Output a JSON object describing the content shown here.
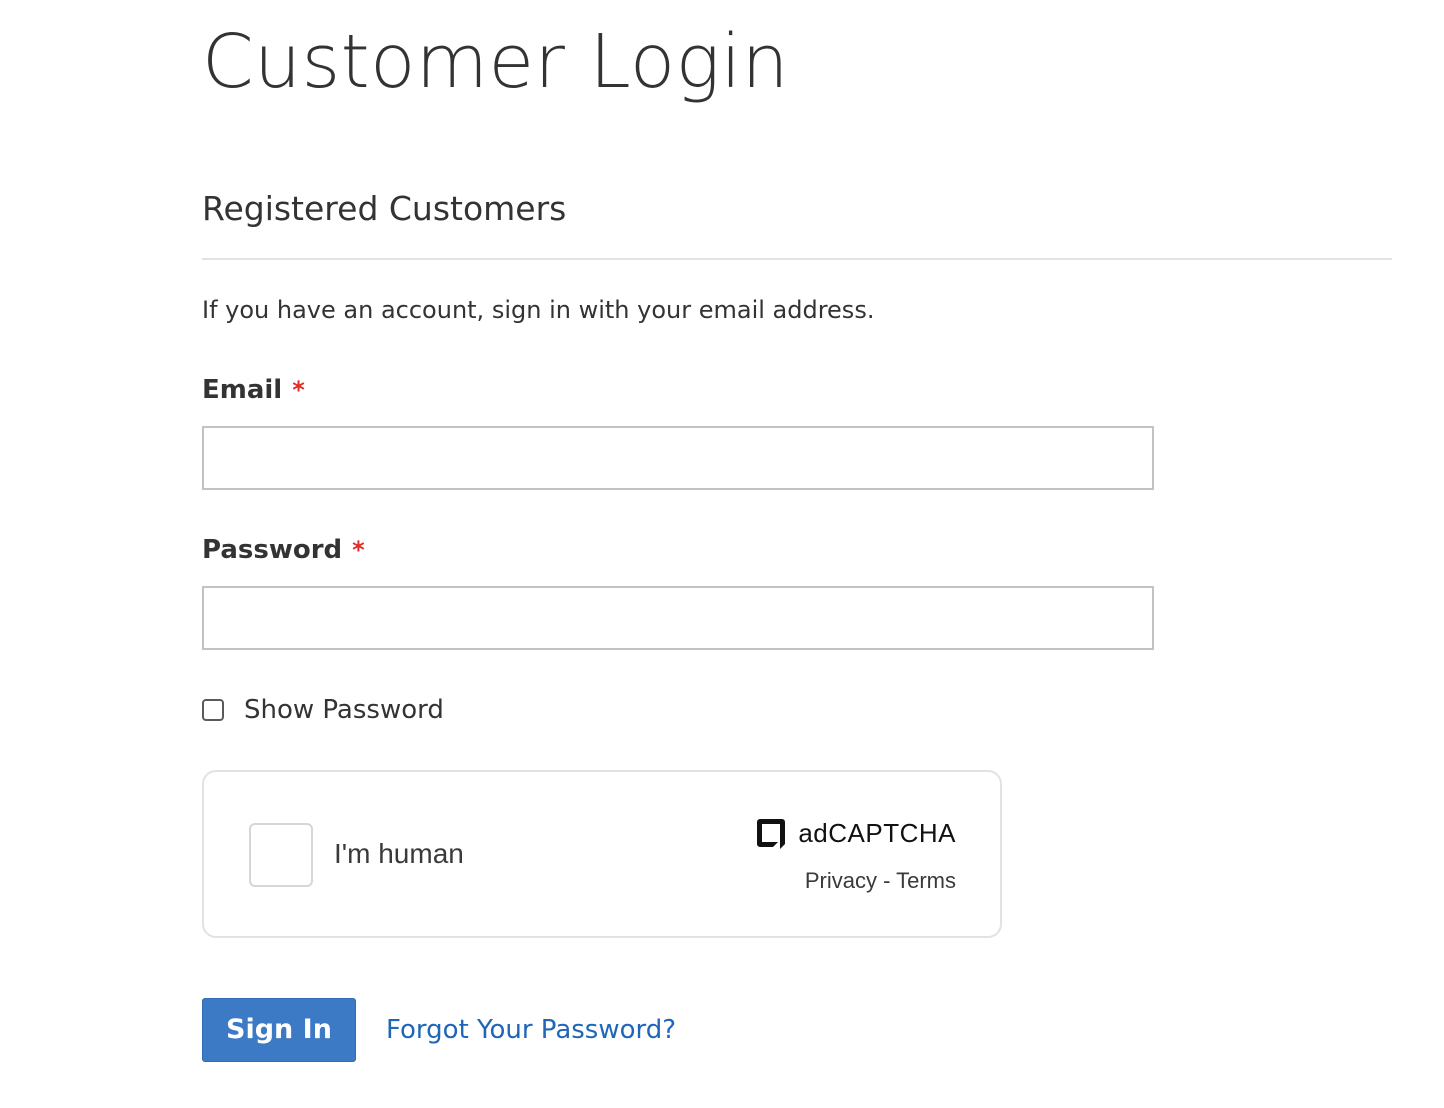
{
  "page": {
    "title": "Customer Login"
  },
  "registered": {
    "block_title": "Registered Customers",
    "intro": "If you have an account, sign in with your email address."
  },
  "form": {
    "email": {
      "label": "Email",
      "required_mark": "*",
      "value": "",
      "placeholder": ""
    },
    "password": {
      "label": "Password",
      "required_mark": "*",
      "value": "",
      "placeholder": ""
    },
    "show_password": {
      "label": "Show Password",
      "checked": false
    }
  },
  "captcha": {
    "label": "I'm human",
    "brand": "adCAPTCHA",
    "privacy_label": "Privacy",
    "separator": " - ",
    "terms_label": "Terms",
    "checked": false
  },
  "actions": {
    "sign_in_label": "Sign In",
    "forgot_password_label": "Forgot Your Password?"
  },
  "colors": {
    "primary_button": "#3c7ac5",
    "link": "#1f66b8",
    "required": "#e02b27",
    "text": "#333333"
  }
}
